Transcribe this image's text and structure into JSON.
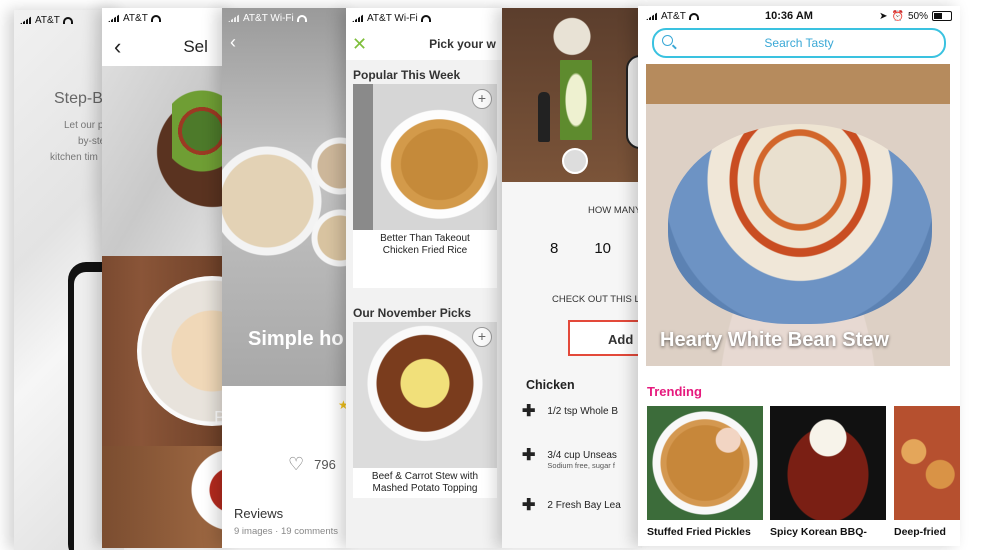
{
  "phone1": {
    "carrier": "AT&T",
    "heading": "Step-B",
    "subtitle_lines": [
      "Let our pro",
      "by-step",
      "kitchen tim"
    ]
  },
  "phone2": {
    "carrier": "AT&T",
    "title": "Sel",
    "label": "B"
  },
  "phone3": {
    "carrier": "AT&T Wi-Fi",
    "title": "Simple ho",
    "likes": "796",
    "reviews_heading": "Reviews",
    "reviews_meta": "9 images · 19 comments"
  },
  "phone4": {
    "carrier": "AT&T Wi-Fi",
    "nav_title": "Pick your w",
    "sections": [
      {
        "title": "Popular This Week",
        "card_caption_lines": [
          "Better Than Takeout",
          "Chicken Fried Rice"
        ]
      },
      {
        "title": "Our November Picks",
        "card_caption_lines": [
          "Beef & Carrot Stew with",
          "Mashed Potato Topping"
        ]
      }
    ]
  },
  "phone5": {
    "question": "HOW MANY",
    "servings": [
      "8",
      "10"
    ],
    "check_out": "CHECK OUT THIS L",
    "add_label": "Add",
    "group": "Chicken",
    "ingredients": [
      {
        "text": "1/2 tsp Whole B",
        "note": ""
      },
      {
        "text": "3/4 cup Unseas",
        "note": "Sodium free, sugar f"
      },
      {
        "text": "2 Fresh Bay Lea",
        "note": ""
      }
    ]
  },
  "phone6": {
    "carrier": "AT&T",
    "time": "10:36 AM",
    "battery": "50%",
    "search_placeholder": "Search Tasty",
    "hero_title": "Hearty White Bean Stew",
    "trending_label": "Trending",
    "trending": [
      "Stuffed Fried Pickles",
      "Spicy Korean BBQ-",
      "Deep-fried"
    ]
  },
  "colors": {
    "accent_pink": "#e6197d",
    "search_blue": "#3ac2e0",
    "add_border_red": "#e3493a",
    "close_green": "#7fbf3b"
  }
}
